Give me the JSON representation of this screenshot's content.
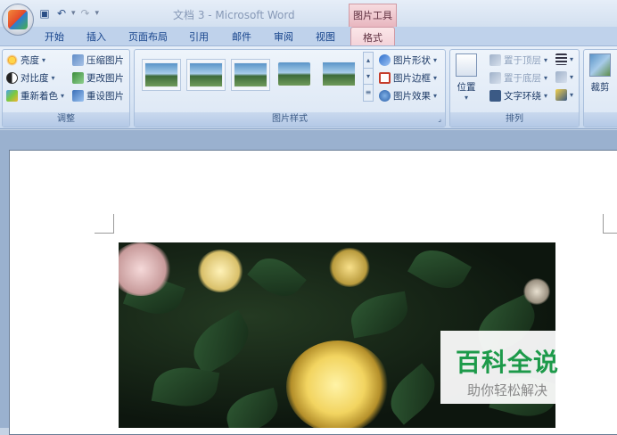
{
  "window": {
    "title": "文档 3 - Microsoft Word",
    "contextual_title": "图片工具"
  },
  "tabs": {
    "items": [
      "开始",
      "插入",
      "页面布局",
      "引用",
      "邮件",
      "审阅",
      "视图"
    ],
    "active": "格式"
  },
  "ribbon": {
    "adjust": {
      "label": "调整",
      "brightness": "亮度",
      "contrast": "对比度",
      "recolor": "重新着色",
      "compress": "压缩图片",
      "change": "更改图片",
      "reset": "重设图片"
    },
    "styles": {
      "label": "图片样式",
      "shape": "图片形状",
      "border": "图片边框",
      "effects": "图片效果"
    },
    "arrange": {
      "label": "排列",
      "position": "位置",
      "bring_front": "置于顶层",
      "send_back": "置于底层",
      "text_wrap": "文字环绕"
    },
    "size": {
      "crop": "裁剪"
    }
  },
  "watermark": {
    "main": "百科全说",
    "sub": "助你轻松解决"
  },
  "colors": {
    "accent": "#15428b",
    "context_tab": "#f3d2d8",
    "watermark_green": "#1d9a4a"
  }
}
